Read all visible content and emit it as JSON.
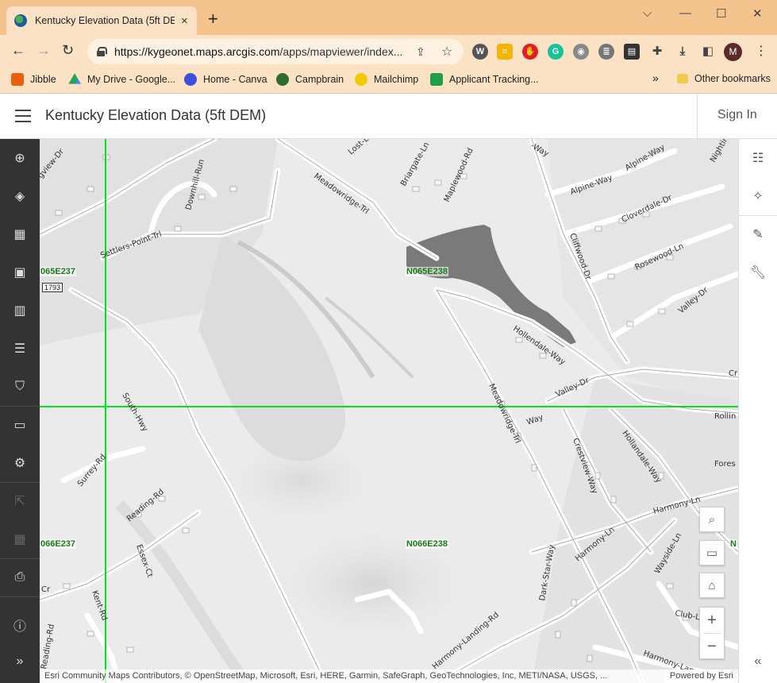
{
  "browser": {
    "tab_title": "Kentucky Elevation Data (5ft DEM",
    "tab_close": "×",
    "new_tab": "+",
    "window_controls": [
      "⌵",
      "—",
      "☐",
      "✕"
    ],
    "url_host": "https://kygeonet.maps.arcgis.com",
    "url_path": "/apps/mapviewer/index...",
    "profile_initial": "M",
    "bookmarks": [
      {
        "label": "Jibble",
        "icon": "jibble-icon",
        "color": "#e8600e"
      },
      {
        "label": "My Drive - Google...",
        "icon": "google-drive-icon",
        "color": "#1fa463"
      },
      {
        "label": "Home - Canva",
        "icon": "canva-icon",
        "color": "#3f51d8"
      },
      {
        "label": "Campbrain",
        "icon": "campbrain-icon",
        "color": "#2f6b2f"
      },
      {
        "label": "Mailchimp",
        "icon": "mailchimp-icon",
        "color": "#f3c900"
      },
      {
        "label": "Applicant Tracking...",
        "icon": "applicant-tracking-icon",
        "color": "#1e9e46"
      }
    ],
    "bookmarks_overflow": "»",
    "other_bookmarks": "Other bookmarks"
  },
  "app": {
    "title": "Kentucky Elevation Data (5ft DEM)",
    "sign_in": "Sign In"
  },
  "map": {
    "grid_labels": [
      "065E237",
      "N065E238",
      "066E237",
      "N066E238",
      "N"
    ],
    "route_shield": "1793",
    "roads": [
      "Lost-L",
      "Briargate-Ln",
      "Maplewood-Rd",
      "Meadowridge-Trl",
      "Settlers-Point-Trl",
      "Downhill-Run",
      "Alpine-Way",
      "Alpine-Way",
      "Nightin",
      "Cloverdale-Dr",
      "Cliffwood-Dr",
      "Rosewood-Ln",
      "Valley-Dr",
      "Hollendale-Way",
      "Valley-Dr",
      "Rollin",
      "Crestview-Way",
      "Hollandale-Way",
      "Fores",
      "Meadowridge-Trl",
      "South-Hwy",
      "Surrey-Rd",
      "Reading-Rd",
      "Essex-Ct",
      "Harmony-Ln",
      "Harmony-Ln",
      "Wayside-Ln",
      "Club-L",
      "Harmony-Landing-Rd",
      "Dark-Star-Way",
      "Harmony-Lan",
      "Kent-Rd",
      "Reading-Rd",
      "Cr",
      "Way",
      "Cr",
      "gview-Dr",
      "-Way"
    ],
    "attribution": "Esri Community Maps Contributors, © OpenStreetMap, Microsoft, Esri, HERE, Garmin, SafeGraph, GeoTechnologies, Inc, METI/NASA, USGS, ...",
    "powered_by": "Powered by Esri",
    "grid_line_color": "#00e21a",
    "water_color": "#7a7a7a"
  }
}
